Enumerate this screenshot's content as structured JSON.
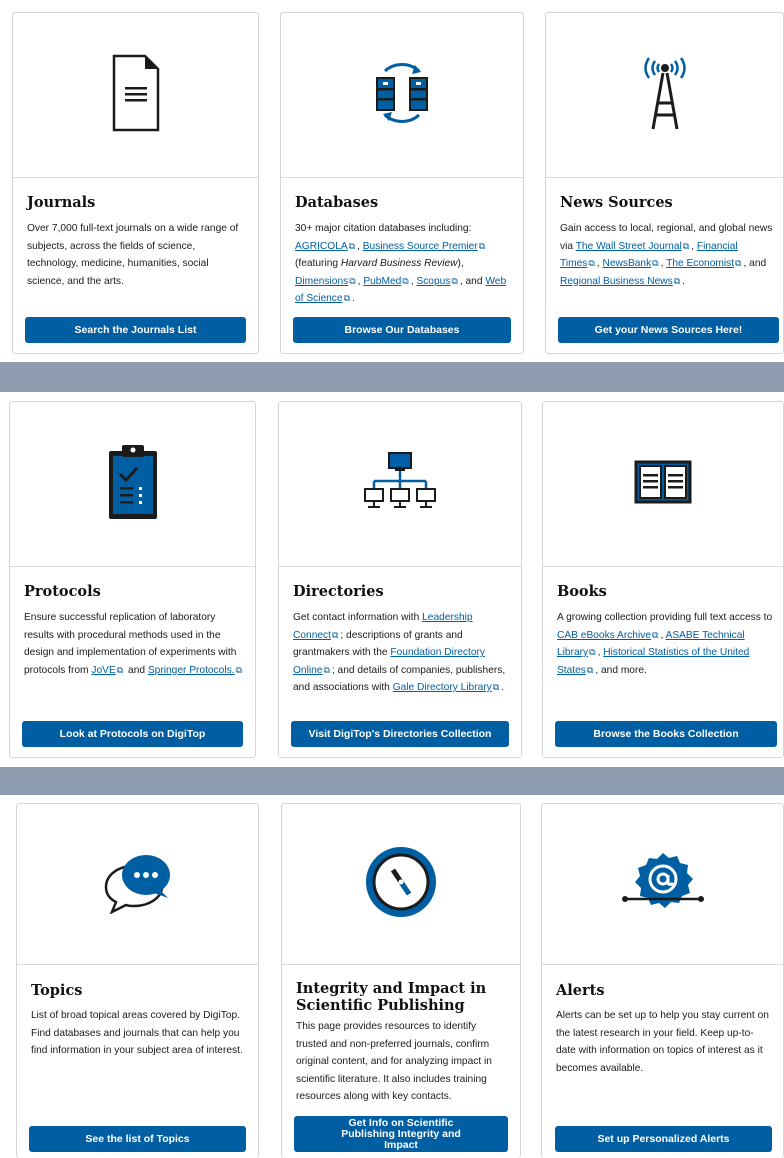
{
  "cards": [
    {
      "icon": "document-icon",
      "title": "Journals",
      "desc": "Over 7,000 full-text journals on a wide range of subjects, across the fields of science, technology, medicine, humanities, social science, and the arts.",
      "button": "Search the Journals List"
    },
    {
      "icon": "databases-sync-icon",
      "title": "Databases",
      "desc_intro": "30+ major citation databases including:",
      "links": [
        "AGRICOLA",
        "Business Source Premier",
        "Dimensions",
        "PubMed",
        "Scopus",
        "Web of Science"
      ],
      "desc_featuring": "(featuring",
      "desc_hbr": "Harvard Business Review",
      "desc_and": "and",
      "button": "Browse Our Databases"
    },
    {
      "icon": "antenna-tower-icon",
      "title": "News Sources",
      "desc_intro": "Gain access to local, regional, and global news via",
      "links": [
        "The Wall Street Journal",
        "Financial Times",
        "NewsBank",
        "The Economist",
        "Regional Business News"
      ],
      "desc_and": "and",
      "button": "Get your News Sources Here!"
    },
    {
      "icon": "clipboard-checklist-icon",
      "title": "Protocols",
      "desc_intro": "Ensure successful replication of laboratory results with procedural methods used in the design and implementation of experiments with protocols from",
      "links": [
        "JoVE",
        "Springer Protocols."
      ],
      "desc_and": "and",
      "button": "Look at Protocols on DigiTop"
    },
    {
      "icon": "network-hierarchy-icon",
      "title": "Directories",
      "desc_intro": "Get contact information with",
      "links": [
        "Leadership Connect",
        "Foundation Directory Online",
        "Gale Directory Library"
      ],
      "desc_mid1": "; descriptions of grants and grantmakers with the",
      "desc_mid2": "; and details of companies, publishers, and associations with",
      "button": "Visit DigiTop's Directories Collection"
    },
    {
      "icon": "open-book-icon",
      "title": "Books",
      "desc_intro": "A growing collection providing full text access to",
      "links": [
        "CAB eBooks Archive",
        "ASABE Technical Library",
        "Historical Statistics of the United States"
      ],
      "desc_end": ", and more.",
      "button": "Browse the Books Collection"
    },
    {
      "icon": "chat-bubbles-icon",
      "title": "Topics",
      "desc": "List of broad topical areas covered by DigiTop. Find databases and journals that can help you find information in your subject area of interest.",
      "button": "See the list of Topics"
    },
    {
      "icon": "compass-icon",
      "title": "Integrity and Impact in Scientific Publishing",
      "desc": "This page provides resources to identify trusted and non-preferred journals, confirm original content, and for analyzing impact in scientific literature. It also includes training resources along with key contacts.",
      "button": "Get Info on Scientific Publishing Integrity and Impact"
    },
    {
      "icon": "at-sign-badge-icon",
      "title": "Alerts",
      "desc": "Alerts can be set up to help you stay current on the latest research in your field. Keep up-to-date with information on topics of interest as it becomes available.",
      "button": "Set up Personalized Alerts"
    }
  ],
  "colors": {
    "accent": "#005ea2",
    "icon_dark": "#1b1b1b",
    "background": "#8e9db0"
  }
}
